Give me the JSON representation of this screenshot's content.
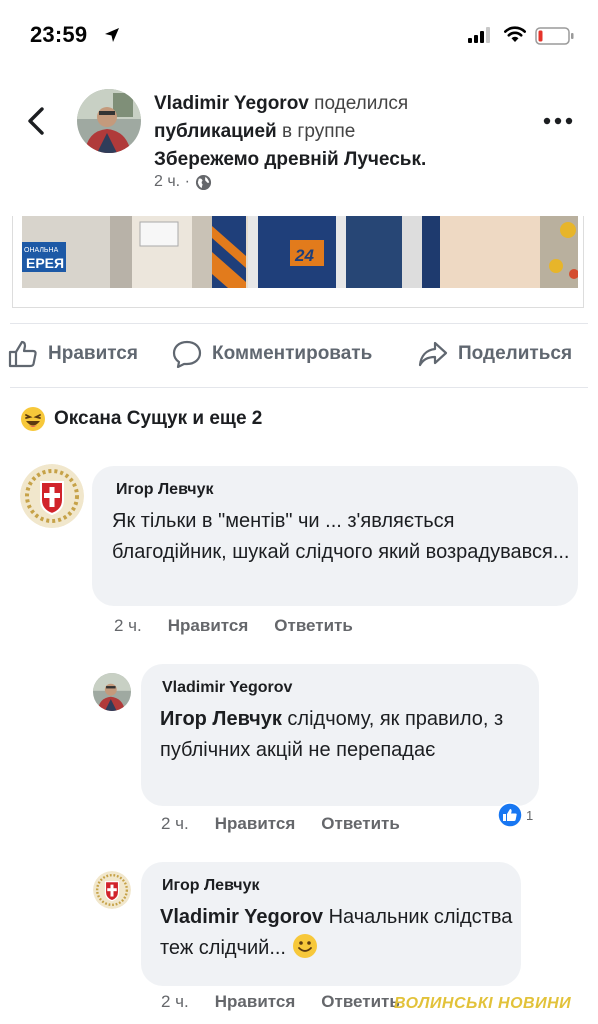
{
  "status_bar": {
    "time": "23:59"
  },
  "header": {
    "author": "Vladimir Yegorov",
    "shared_text": "поделился",
    "shared_object": "публикацией",
    "in_group_text": "в группе",
    "group": "Збережемо древній Лучеськ.",
    "time": "2 ч. ·"
  },
  "actions": {
    "like": "Нравится",
    "comment": "Комментировать",
    "share": "Поделиться"
  },
  "reactions_summary": "Оксана Сущук и еще 2",
  "comments": [
    {
      "author": "Игор Левчук",
      "text": "Як тільки в \"ментів\" чи ... з'являється благодійник, шукай слідчого який возрадувався...",
      "time": "2 ч.",
      "like": "Нравится",
      "reply": "Ответить"
    },
    {
      "author": "Vladimir Yegorov",
      "mention": "Игор Левчук",
      "text": " слідчому, як правило, з публічних акцій не перепадає",
      "time": "2 ч.",
      "like": "Нравится",
      "reply": "Ответить",
      "reaction_count": "1"
    },
    {
      "author": "Игор Левчук",
      "mention": "Vladimir Yegorov",
      "text": " Начальник слідства теж слідчий...",
      "time": "2 ч.",
      "like": "Нравится",
      "reply": "Ответить"
    }
  ],
  "post_image": {
    "sign_text": "ЕРЕЯ",
    "sign_text_small": "ОНАЛЬНА",
    "badge": "24"
  },
  "watermark": "ВОЛИНСЬКІ НОВИНИ",
  "colors": {
    "link_gray": "#65676b",
    "bubble": "#f0f2f5",
    "like_blue": "#1877f2"
  },
  "icons": [
    "location-arrow-icon",
    "cellular-signal-icon",
    "wifi-icon",
    "battery-low-icon",
    "back-chevron-icon",
    "more-dots-icon",
    "globe-icon",
    "like-thumb-icon",
    "comment-bubble-icon",
    "share-arrow-icon",
    "laughing-emoji-icon",
    "smile-emoji-icon"
  ]
}
